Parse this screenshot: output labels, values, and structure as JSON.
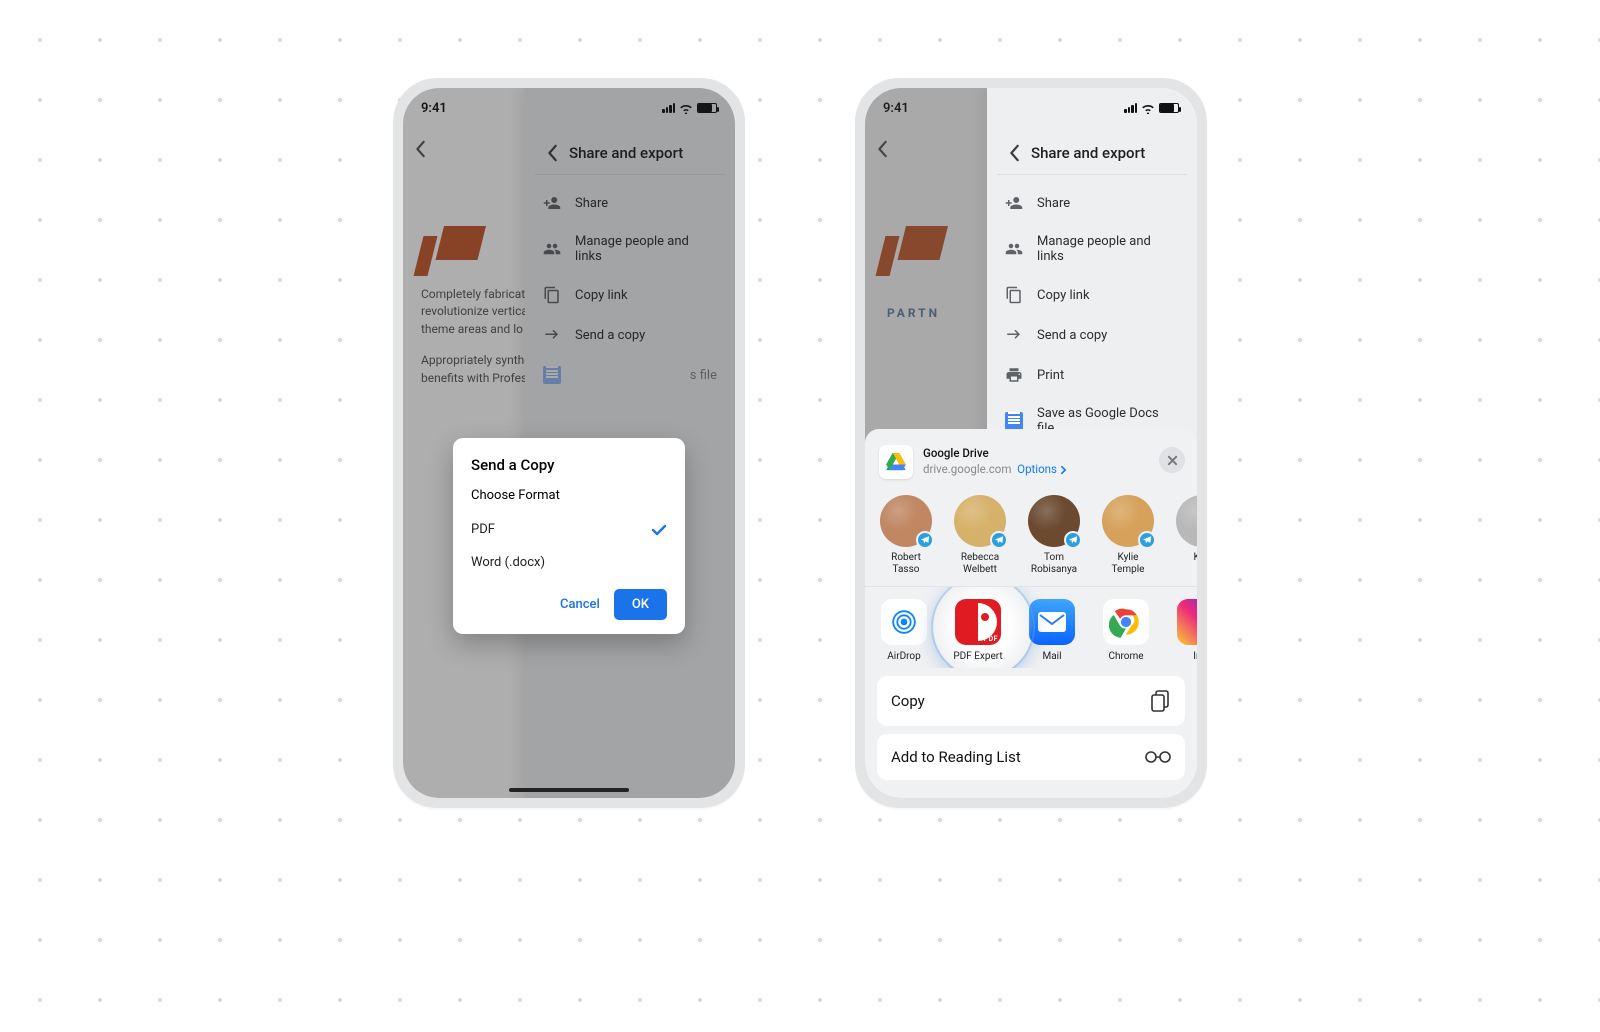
{
  "statusbar": {
    "time": "9:41"
  },
  "panel": {
    "title": "Share and export",
    "items": [
      {
        "label": "Share"
      },
      {
        "label": "Manage people and links"
      },
      {
        "label": "Copy link"
      },
      {
        "label": "Send a copy"
      },
      {
        "label": "Print"
      },
      {
        "label": "Save as Google Docs file"
      }
    ]
  },
  "doc": {
    "partner": "PARTN",
    "para1": "Completely fabricate vertical worldwide managed revolutionize vertical intertwined markets. Proactively theme areas and lo",
    "para2": "Appropriately synthesize inexpensive intellectual timely benefits with Professionally productize open-source.",
    "docs_item_partial": "s file"
  },
  "modal": {
    "title": "Send a Copy",
    "subtitle": "Choose Format",
    "option_pdf": "PDF",
    "option_word": "Word (.docx)",
    "cancel": "Cancel",
    "ok": "OK"
  },
  "sharesheet": {
    "app_name": "Google Drive",
    "app_domain": "drive.google.com",
    "options": "Options",
    "contacts": [
      {
        "name_line1": "Robert",
        "name_line2": "Tasso"
      },
      {
        "name_line1": "Rebecca",
        "name_line2": "Welbett"
      },
      {
        "name_line1": "Tom",
        "name_line2": "Robisanya"
      },
      {
        "name_line1": "Kylie",
        "name_line2": "Temple"
      },
      {
        "name_line1": "Kpe",
        "name_line2": ""
      }
    ],
    "apps": [
      {
        "name": "AirDrop"
      },
      {
        "name": "PDF Expert"
      },
      {
        "name": "Mail"
      },
      {
        "name": "Chrome"
      },
      {
        "name": "Ins"
      }
    ],
    "actions": {
      "copy": "Copy",
      "reading_list": "Add to Reading List"
    }
  },
  "avatar_colors": [
    "#c08762",
    "#d6b16a",
    "#6b4a30",
    "#d6a25b",
    "#b8b8b8"
  ]
}
